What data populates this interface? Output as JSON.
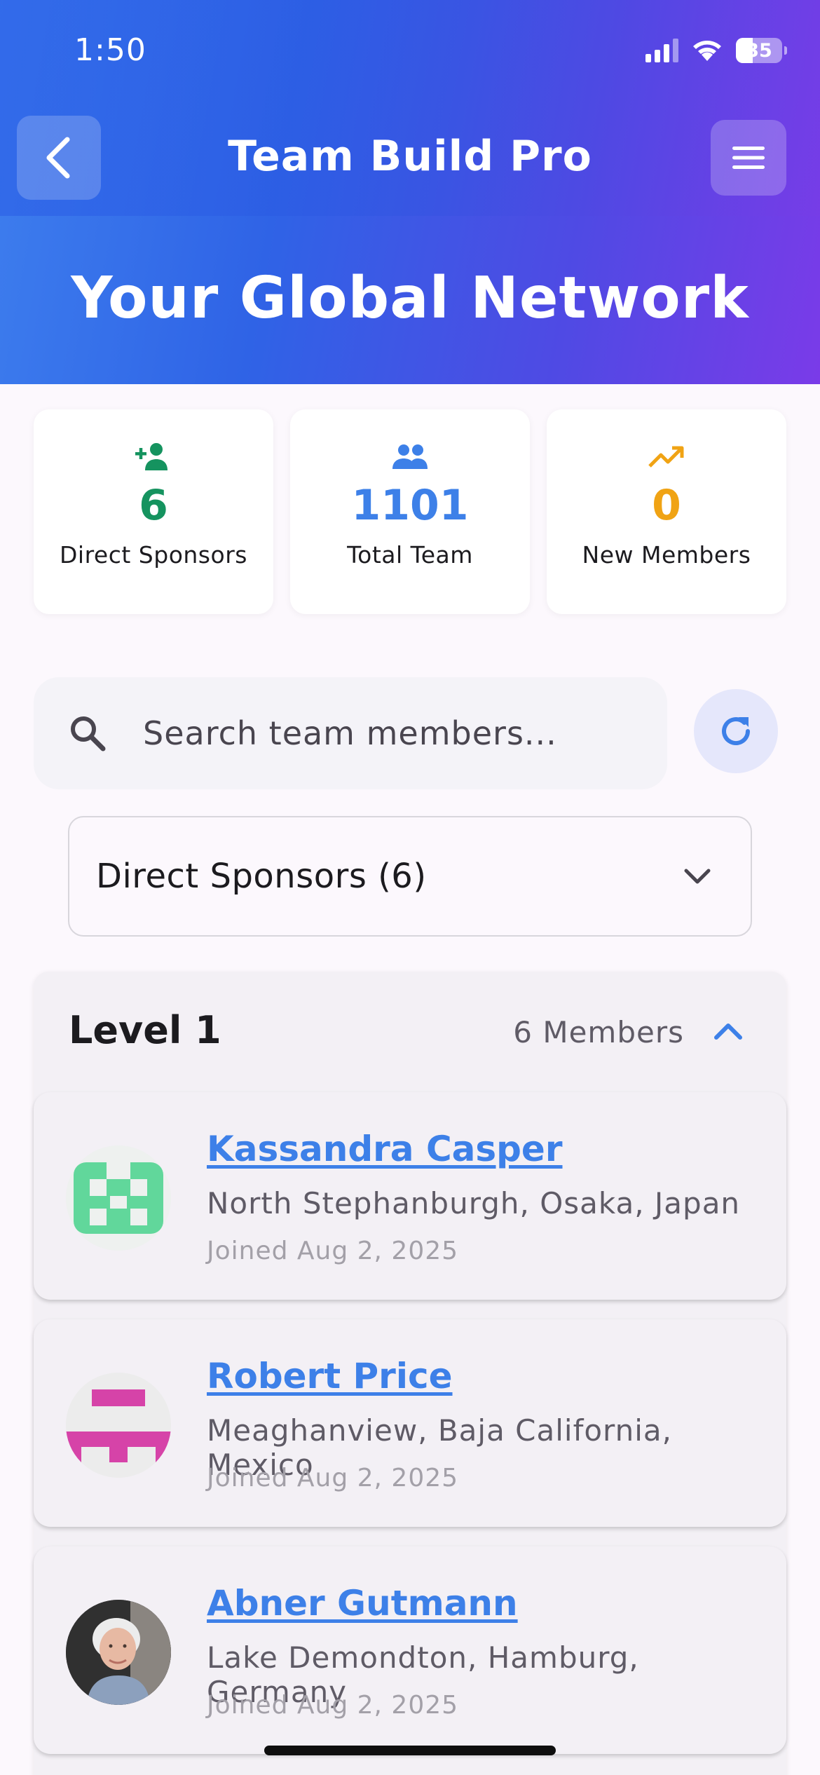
{
  "status_bar": {
    "time": "1:50",
    "battery": "35"
  },
  "app_bar": {
    "title": "Team Build Pro",
    "back_icon": "chevron-left-icon",
    "menu_icon": "hamburger-menu-icon"
  },
  "hero": {
    "title": "Your Global Network"
  },
  "stats": [
    {
      "value": "6",
      "label": "Direct Sponsors",
      "icon": "person-add-icon",
      "color": "#15935f"
    },
    {
      "value": "1101",
      "label": "Total Team",
      "icon": "group-icon",
      "color": "#3d80e8"
    },
    {
      "value": "0",
      "label": "New Members",
      "icon": "trending-up-icon",
      "color": "#f0a314"
    }
  ],
  "search": {
    "placeholder": "Search team members...",
    "value": ""
  },
  "filter": {
    "selected": "Direct Sponsors (6)"
  },
  "level": {
    "title": "Level 1",
    "count": "6 Members",
    "members": [
      {
        "name": "Kassandra Casper",
        "location": "North Stephanburgh, Osaka, Japan",
        "joined": "Joined Aug 2, 2025",
        "avatar": "identicon-green"
      },
      {
        "name": "Robert Price",
        "location": "Meaghanview, Baja California, Mexico",
        "joined": "Joined Aug 2, 2025",
        "avatar": "identicon-magenta"
      },
      {
        "name": "Abner Gutmann",
        "location": "Lake Demondton, Hamburg, Germany",
        "joined": "Joined Aug 2, 2025",
        "avatar": "photo"
      }
    ]
  },
  "colors": {
    "accent": "#3d80e8",
    "hero_start": "#3e7fee",
    "hero_end": "#7a3be8"
  }
}
